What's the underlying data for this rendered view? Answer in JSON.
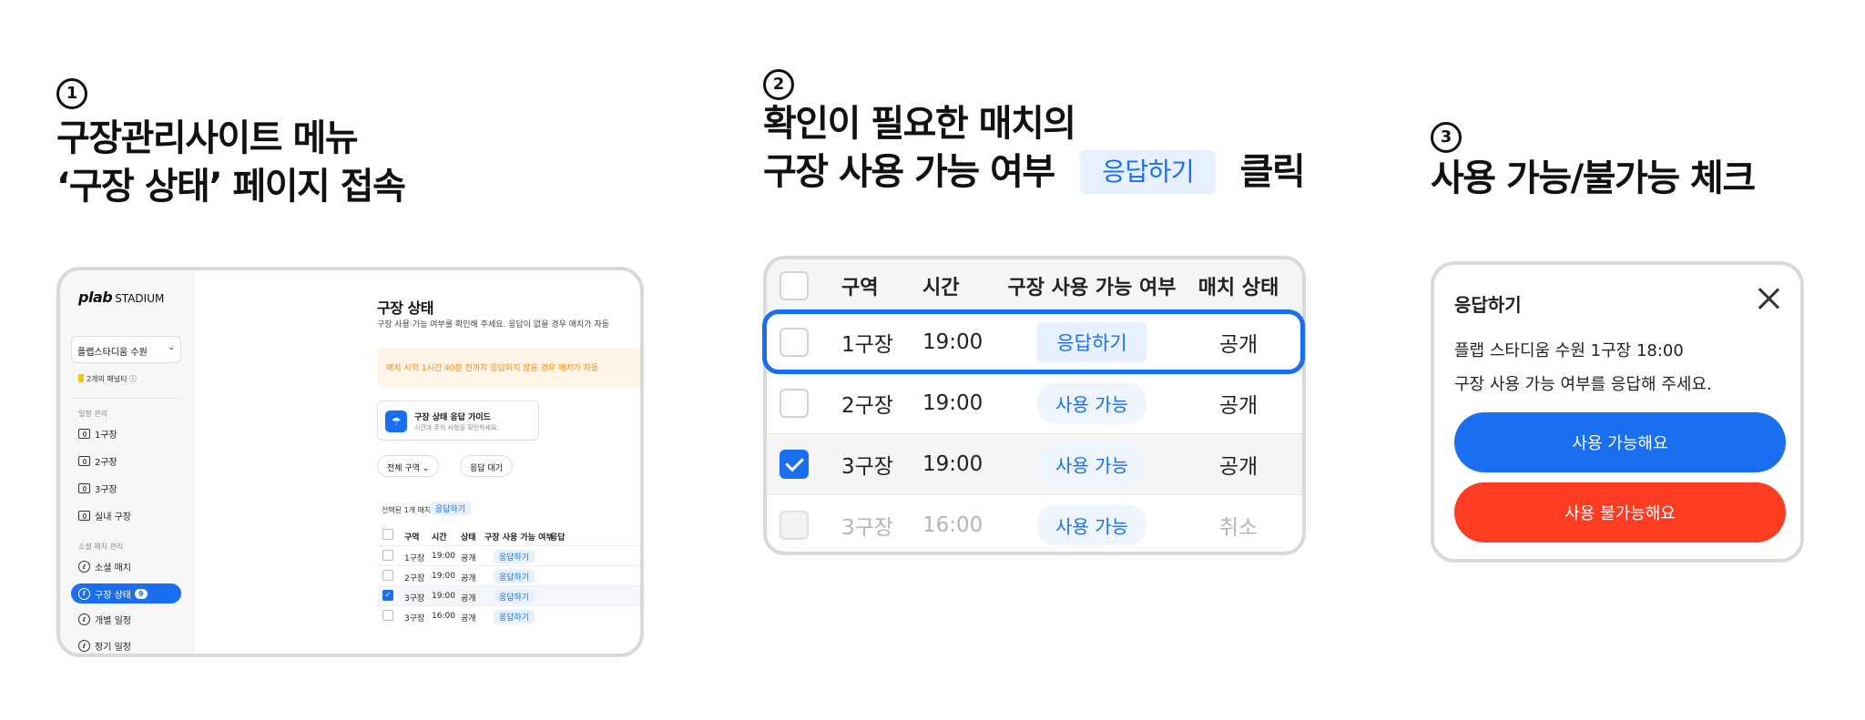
{
  "step1": {
    "number": "1",
    "line1": "구장관리사이트 메뉴",
    "line2": "‘구장 상태’ 페이지  접속",
    "app": {
      "logo": "plab",
      "logo_sub": "STADIUM",
      "store": "플랩스타디움 수원",
      "penalty": "2개의 패널티",
      "section_schedule": "일정 관리",
      "courts": [
        "1구장",
        "2구장",
        "3구장",
        "실내 구장"
      ],
      "section_social": "소셜 매치 관리",
      "social_match": "소셜 매치",
      "court_status": "구장 상태",
      "court_status_count": "9",
      "personal_schedule": "개별 일정",
      "regular_schedule": "정기 일정",
      "page_title": "구장 상태",
      "page_desc": "구장 사용 가능 여부를 확인해 주세요. 응답이 없을 경우 매치가 자동",
      "warning": "매치 시작 1시간 40분 전까지 응답하지 않을 경우 매치가 자동",
      "guide_title": "구장 상태 응답 가이드",
      "guide_sub": "시간과 주의 사항을 확인하세요.",
      "filter_zone": "전체 구역",
      "filter_wait": "응답 대기",
      "selected_count": "선택된 1개 매치",
      "selected_action": "응답하기",
      "headers": [
        "구역",
        "시간",
        "상태",
        "구장 사용 가능 여부",
        "응답"
      ],
      "rows": [
        {
          "zone": "1구장",
          "time": "19:00",
          "status": "공개",
          "action": "응답하기",
          "checked": false
        },
        {
          "zone": "2구장",
          "time": "19:00",
          "status": "공개",
          "action": "응답하기",
          "checked": false
        },
        {
          "zone": "3구장",
          "time": "19:00",
          "status": "공개",
          "action": "응답하기",
          "checked": true
        },
        {
          "zone": "3구장",
          "time": "16:00",
          "status": "공개",
          "action": "응답하기",
          "checked": false
        }
      ]
    }
  },
  "step2": {
    "number": "2",
    "line1": "확인이 필요한  매치의",
    "line2a": "구장 사용 가능 여부",
    "badge": "응답하기",
    "line2b": "클릭",
    "table": {
      "headers": [
        "구역",
        "시간",
        "구장 사용 가능 여부",
        "매치 상태"
      ],
      "rows": [
        {
          "zone": "1구장",
          "time": "19:00",
          "availability": "응답하기",
          "match_status": "공개"
        },
        {
          "zone": "2구장",
          "time": "19:00",
          "availability": "사용 가능",
          "match_status": "공개"
        },
        {
          "zone": "3구장",
          "time": "19:00",
          "availability": "사용 가능",
          "match_status": "공개"
        },
        {
          "zone": "3구장",
          "time": "16:00",
          "availability": "사용 가능",
          "match_status": "취소"
        }
      ]
    }
  },
  "step3": {
    "number": "3",
    "line1": "사용 가능/불가능 체크",
    "modal": {
      "title": "응답하기",
      "match": "플랩 스타디움 수원 1구장 18:00",
      "prompt": "구장 사용 가능 여부를 응답해 주세요.",
      "available_button": "사용 가능해요",
      "unavailable_button": "사용 불가능해요"
    }
  },
  "colors": {
    "primary": "#1a6ff0",
    "danger": "#ff3b22",
    "badge_bg": "#e6f0ff",
    "warning": "#ff8a00"
  }
}
